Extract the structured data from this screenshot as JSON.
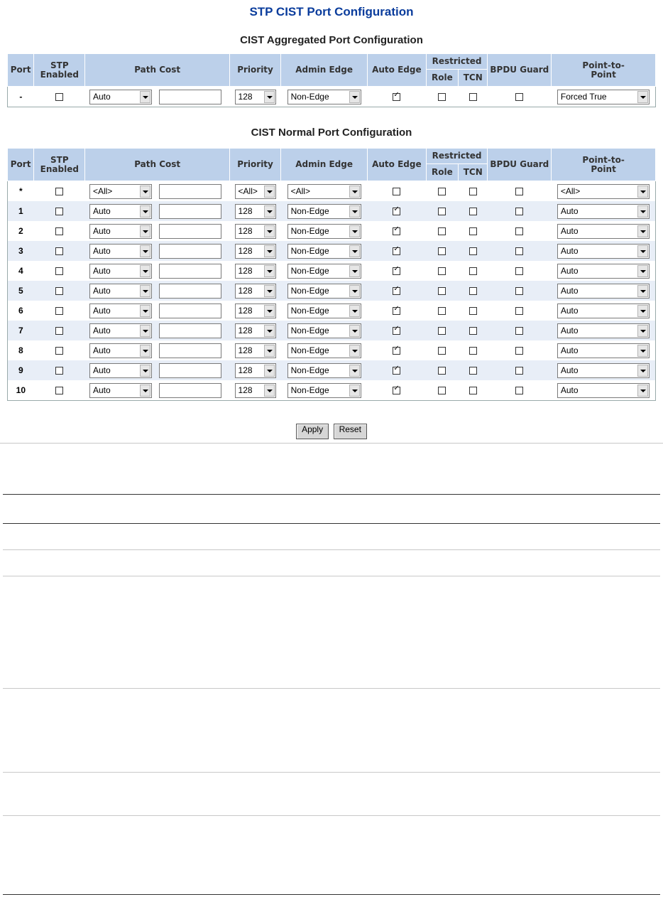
{
  "page_title": "STP CIST Port Configuration",
  "aggregated": {
    "title": "CIST Aggregated Port Configuration",
    "row": {
      "port": "-",
      "stp_enabled": false,
      "path_cost_mode": "Auto",
      "path_cost_value": "",
      "priority": "128",
      "admin_edge": "Non-Edge",
      "auto_edge": true,
      "role": false,
      "tcn": false,
      "bpdu_guard": false,
      "p2p": "Forced True"
    }
  },
  "normal": {
    "title": "CIST Normal Port Configuration",
    "rows": [
      {
        "port": "*",
        "stp_enabled": false,
        "path_cost_mode": "<All>",
        "path_cost_value": "",
        "priority": "<All>",
        "admin_edge": "<All>",
        "auto_edge": false,
        "role": false,
        "tcn": false,
        "bpdu_guard": false,
        "p2p": "<All>"
      },
      {
        "port": "1",
        "stp_enabled": false,
        "path_cost_mode": "Auto",
        "path_cost_value": "",
        "priority": "128",
        "admin_edge": "Non-Edge",
        "auto_edge": true,
        "role": false,
        "tcn": false,
        "bpdu_guard": false,
        "p2p": "Auto"
      },
      {
        "port": "2",
        "stp_enabled": false,
        "path_cost_mode": "Auto",
        "path_cost_value": "",
        "priority": "128",
        "admin_edge": "Non-Edge",
        "auto_edge": true,
        "role": false,
        "tcn": false,
        "bpdu_guard": false,
        "p2p": "Auto"
      },
      {
        "port": "3",
        "stp_enabled": false,
        "path_cost_mode": "Auto",
        "path_cost_value": "",
        "priority": "128",
        "admin_edge": "Non-Edge",
        "auto_edge": true,
        "role": false,
        "tcn": false,
        "bpdu_guard": false,
        "p2p": "Auto"
      },
      {
        "port": "4",
        "stp_enabled": false,
        "path_cost_mode": "Auto",
        "path_cost_value": "",
        "priority": "128",
        "admin_edge": "Non-Edge",
        "auto_edge": true,
        "role": false,
        "tcn": false,
        "bpdu_guard": false,
        "p2p": "Auto"
      },
      {
        "port": "5",
        "stp_enabled": false,
        "path_cost_mode": "Auto",
        "path_cost_value": "",
        "priority": "128",
        "admin_edge": "Non-Edge",
        "auto_edge": true,
        "role": false,
        "tcn": false,
        "bpdu_guard": false,
        "p2p": "Auto"
      },
      {
        "port": "6",
        "stp_enabled": false,
        "path_cost_mode": "Auto",
        "path_cost_value": "",
        "priority": "128",
        "admin_edge": "Non-Edge",
        "auto_edge": true,
        "role": false,
        "tcn": false,
        "bpdu_guard": false,
        "p2p": "Auto"
      },
      {
        "port": "7",
        "stp_enabled": false,
        "path_cost_mode": "Auto",
        "path_cost_value": "",
        "priority": "128",
        "admin_edge": "Non-Edge",
        "auto_edge": true,
        "role": false,
        "tcn": false,
        "bpdu_guard": false,
        "p2p": "Auto"
      },
      {
        "port": "8",
        "stp_enabled": false,
        "path_cost_mode": "Auto",
        "path_cost_value": "",
        "priority": "128",
        "admin_edge": "Non-Edge",
        "auto_edge": true,
        "role": false,
        "tcn": false,
        "bpdu_guard": false,
        "p2p": "Auto"
      },
      {
        "port": "9",
        "stp_enabled": false,
        "path_cost_mode": "Auto",
        "path_cost_value": "",
        "priority": "128",
        "admin_edge": "Non-Edge",
        "auto_edge": true,
        "role": false,
        "tcn": false,
        "bpdu_guard": false,
        "p2p": "Auto"
      },
      {
        "port": "10",
        "stp_enabled": false,
        "path_cost_mode": "Auto",
        "path_cost_value": "",
        "priority": "128",
        "admin_edge": "Non-Edge",
        "auto_edge": true,
        "role": false,
        "tcn": false,
        "bpdu_guard": false,
        "p2p": "Auto"
      }
    ]
  },
  "headers": {
    "port": "Port",
    "stp_enabled": "STP Enabled",
    "path_cost": "Path Cost",
    "priority": "Priority",
    "admin_edge": "Admin Edge",
    "auto_edge": "Auto Edge",
    "restricted": "Restricted",
    "role": "Role",
    "tcn": "TCN",
    "bpdu_guard": "BPDU Guard",
    "p2p": "Point-to-Point"
  },
  "buttons": {
    "apply": "Apply",
    "reset": "Reset"
  }
}
